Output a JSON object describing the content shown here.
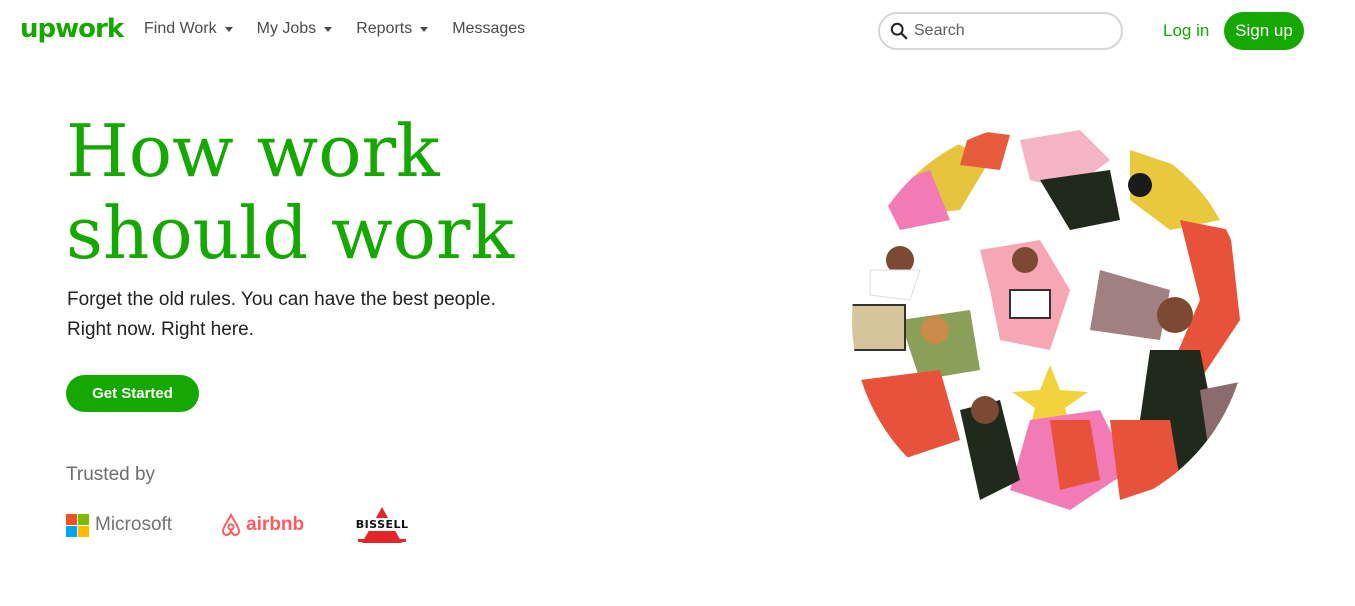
{
  "header": {
    "logo": "upwork",
    "nav": [
      {
        "label": "Find Work",
        "dropdown": true
      },
      {
        "label": "My Jobs",
        "dropdown": true
      },
      {
        "label": "Reports",
        "dropdown": true
      },
      {
        "label": "Messages",
        "dropdown": false
      }
    ],
    "search_placeholder": "Search",
    "login_label": "Log in",
    "signup_label": "Sign up"
  },
  "hero": {
    "title_line1": "How work",
    "title_line2": "should work",
    "subtitle_line1": "Forget the old rules. You can have the best people.",
    "subtitle_line2": "Right now. Right here.",
    "cta_label": "Get Started"
  },
  "trusted": {
    "label": "Trusted by",
    "brands": [
      {
        "name": "Microsoft"
      },
      {
        "name": "airbnb"
      },
      {
        "name": "BISSELL"
      }
    ]
  },
  "colors": {
    "brand_green": "#14a800",
    "airbnb_red": "#ff5a5f",
    "bissell_red": "#e4262c",
    "ms_red": "#f25022",
    "ms_green": "#7fba00",
    "ms_blue": "#00a4ef",
    "ms_yellow": "#ffb900"
  }
}
